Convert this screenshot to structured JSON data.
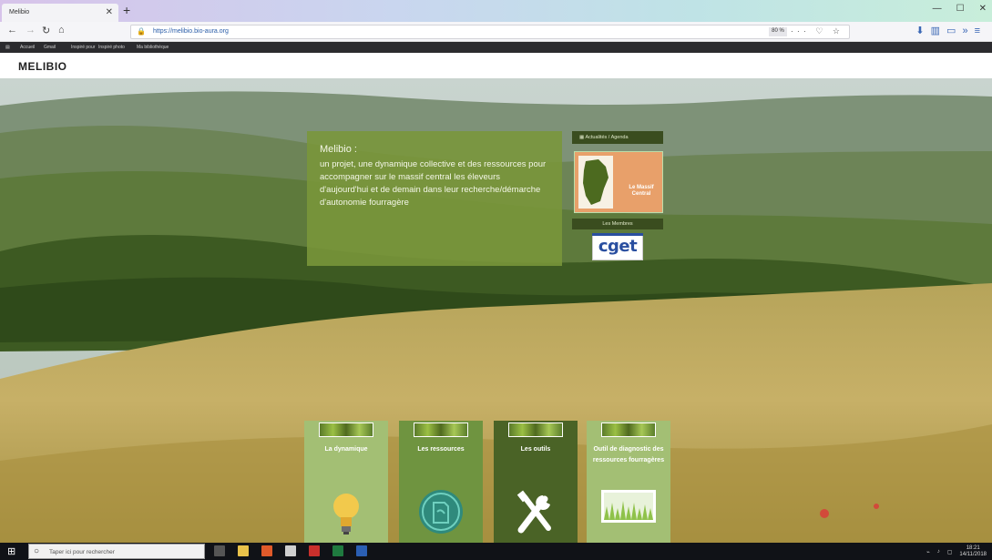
{
  "browser": {
    "tab_title": "Melibio",
    "url": "https://melibio.bio-aura.org",
    "zoom": "80 %",
    "bookmarks": [
      "Accueil",
      "Gmail",
      "Inspiré pour",
      "Inspiré photo",
      "Ma bibliothèque"
    ]
  },
  "site": {
    "logo": "MELIBIO",
    "intro": {
      "title": "Melibio :",
      "body": "un projet, une dynamique collective et des ressources pour accompagner sur le massif central les éleveurs d'aujourd'hui et de demain dans leur recherche/démarche d'autonomie fourragère"
    },
    "news": {
      "header": "Actualités / Agenda",
      "image_caption": "Le Massif Central",
      "footer": "Les Membres",
      "partner_logo": "cget"
    },
    "cards": [
      {
        "title": "La dynamique",
        "icon": "lightbulb-icon",
        "color": "#a3bf74"
      },
      {
        "title": "Les ressources",
        "icon": "document-circle-icon",
        "color": "#6f9440"
      },
      {
        "title": "Les outils",
        "icon": "tools-icon",
        "color": "#4a6326"
      },
      {
        "title": "Outil de diagnostic des ressources fourragères",
        "icon": "meadow-icon",
        "color": "#a3bf74"
      }
    ]
  },
  "taskbar": {
    "search_placeholder": "Taper ici pour rechercher",
    "clock_time": "18:21",
    "clock_date": "14/11/2018"
  },
  "colors": {
    "intro_bg": "#7a963a",
    "news_bar": "#3a4d1f",
    "cget_blue": "#2a4fa0"
  }
}
